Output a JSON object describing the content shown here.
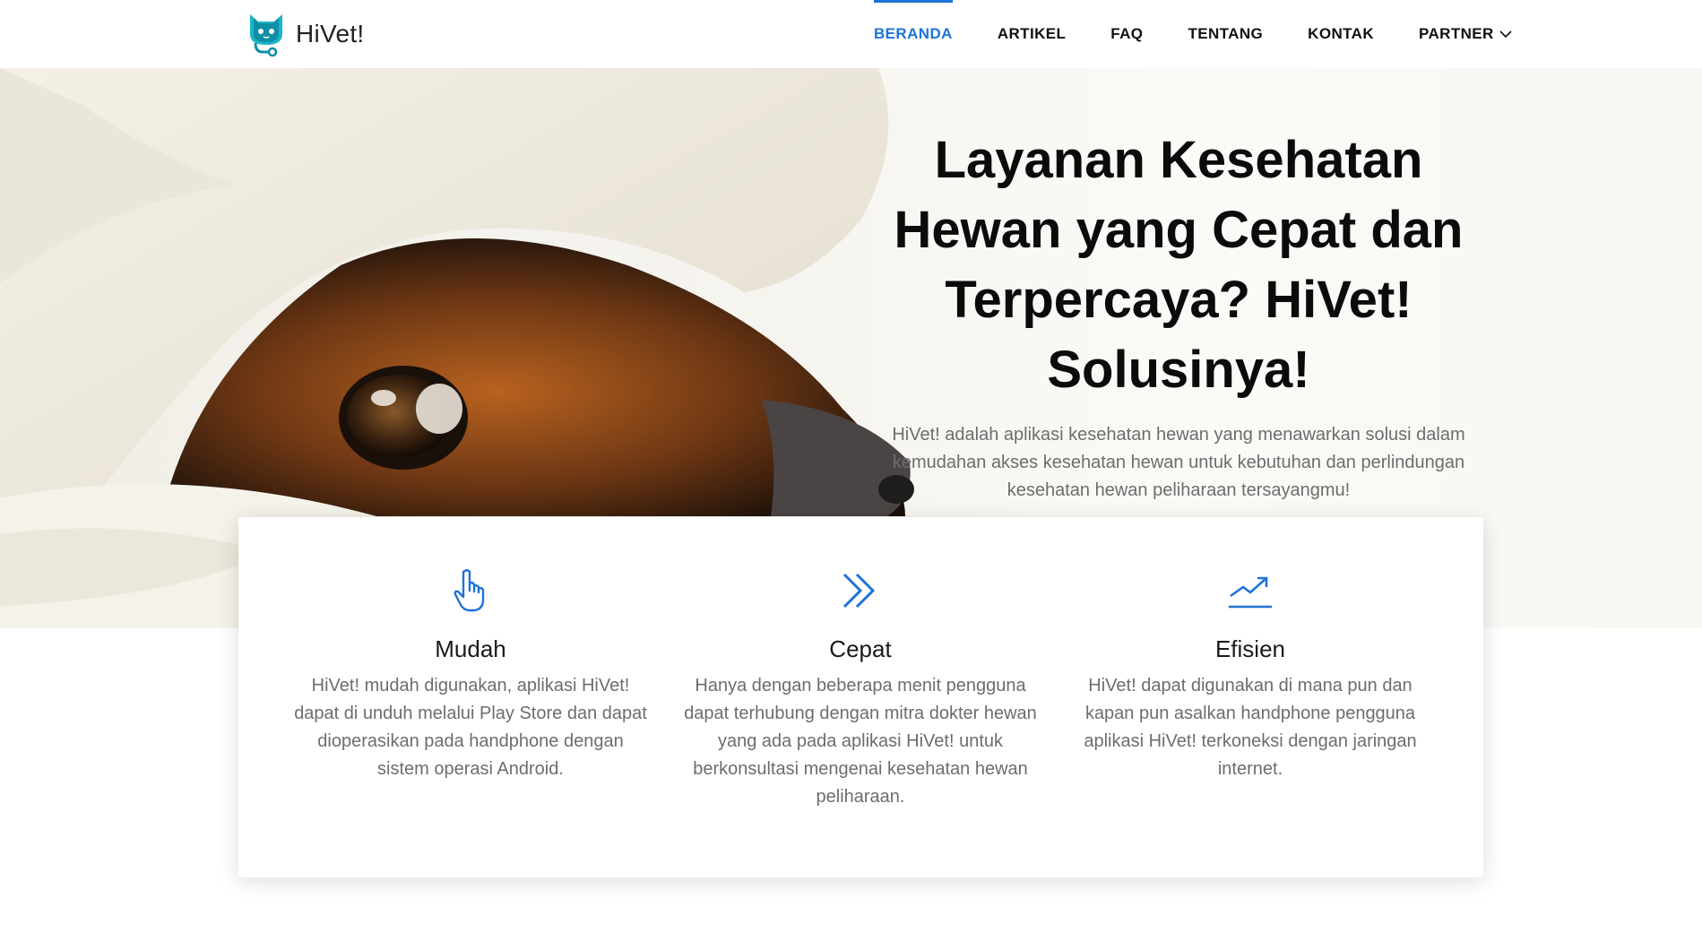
{
  "brand": {
    "name": "HiVet!"
  },
  "nav": {
    "items": [
      {
        "label": "BERANDA",
        "active": true
      },
      {
        "label": "ARTIKEL",
        "active": false
      },
      {
        "label": "FAQ",
        "active": false
      },
      {
        "label": "TENTANG",
        "active": false
      },
      {
        "label": "KONTAK",
        "active": false
      },
      {
        "label": "PARTNER",
        "active": false,
        "dropdown": true
      }
    ]
  },
  "hero": {
    "title": "Layanan Kesehatan Hewan yang Cepat dan Terpercaya? HiVet! Solusinya!",
    "subtitle": "HiVet! adalah aplikasi kesehatan hewan yang menawarkan solusi dalam kemudahan akses kesehatan hewan untuk kebutuhan dan perlindungan kesehatan hewan peliharaan tersayangmu!"
  },
  "features": [
    {
      "icon": "hand-pointer-icon",
      "title": "Mudah",
      "description": "HiVet! mudah digunakan, aplikasi HiVet! dapat di unduh melalui Play Store dan dapat dioperasikan pada handphone dengan sistem operasi Android."
    },
    {
      "icon": "double-chevron-right-icon",
      "title": "Cepat",
      "description": "Hanya dengan beberapa menit pengguna dapat terhubung dengan mitra dokter hewan yang ada pada aplikasi HiVet! untuk berkonsultasi mengenai kesehatan hewan peliharaan."
    },
    {
      "icon": "trending-up-icon",
      "title": "Efisien",
      "description": "HiVet! dapat digunakan di mana pun dan kapan pun asalkan handphone pengguna aplikasi HiVet! terkoneksi dengan jaringan internet."
    }
  ],
  "colors": {
    "accent": "#1e73d8",
    "logo": "#1bb5c9",
    "text": "#0b0b0b",
    "muted": "#6d6d6d"
  }
}
